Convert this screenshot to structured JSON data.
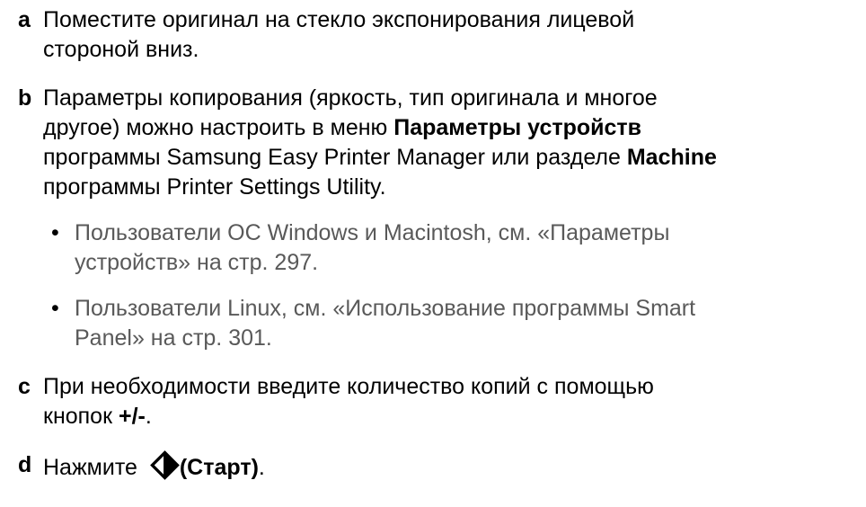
{
  "steps": {
    "a": {
      "letter": "a",
      "line1": "Поместите оригинал на стекло экспонирования лицевой",
      "line2": "стороной вниз."
    },
    "b": {
      "letter": "b",
      "line1": "Параметры копирования (яркость, тип оригинала и многое",
      "line2_pre": "другое) можно настроить в меню ",
      "line2_bold": "Параметры устройств",
      "line3_pre": "программы Samsung Easy Printer Manager или разделе ",
      "line3_bold": "Machine",
      "line4": "программы Printer Settings Utility.",
      "bullets": [
        {
          "line1": "Пользователи ОС Windows и Macintosh, см. «Параметры",
          "line2": "устройств» на стр. 297."
        },
        {
          "line1": "Пользователи Linux, см. «Использование программы Smart",
          "line2": "Panel» на стр. 301."
        }
      ]
    },
    "c": {
      "letter": "c",
      "line1": "При необходимости введите количество копий с помощью",
      "line2_pre": "кнопок ",
      "line2_bold": "+/-",
      "line2_post": "."
    },
    "d": {
      "letter": "d",
      "text_pre": "Нажмите ",
      "icon": "start-icon",
      "text_bold": "(Старт)",
      "text_post": "."
    }
  },
  "bullet_symbol": "•"
}
